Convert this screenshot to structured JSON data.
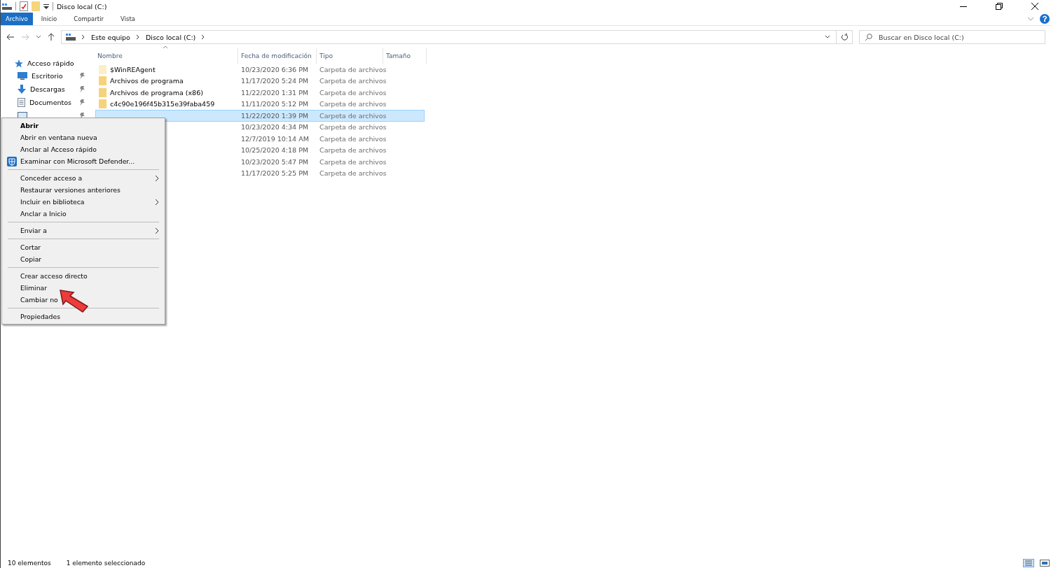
{
  "window": {
    "title": "Disco local (C:)"
  },
  "ribbon_tabs": [
    {
      "label": "Archivo",
      "selected": true
    },
    {
      "label": "Inicio",
      "selected": false
    },
    {
      "label": "Compartir",
      "selected": false
    },
    {
      "label": "Vista",
      "selected": false
    }
  ],
  "breadcrumb": [
    "Este equipo",
    "Disco local (C:)"
  ],
  "search": {
    "placeholder": "Buscar en Disco local (C:)"
  },
  "sidebar": {
    "items": [
      {
        "label": "Acceso rápido",
        "kind": "star",
        "pinned": false
      },
      {
        "label": "Escritorio",
        "kind": "desktop",
        "pinned": true
      },
      {
        "label": "Descargas",
        "kind": "download",
        "pinned": true
      },
      {
        "label": "Documentos",
        "kind": "document",
        "pinned": true
      },
      {
        "kind": "image",
        "pinned": true
      }
    ]
  },
  "table": {
    "columns": [
      "Nombre",
      "Fecha de modificación",
      "Tipo",
      "Tamaño"
    ],
    "rows": [
      {
        "name": "$WinREAgent",
        "date": "10/23/2020 6:36 PM",
        "type": "Carpeta de archivos",
        "selected": false
      },
      {
        "name": "Archivos de programa",
        "date": "11/17/2020 5:24 PM",
        "type": "Carpeta de archivos",
        "selected": false
      },
      {
        "name": "Archivos de programa (x86)",
        "date": "11/22/2020 1:31 PM",
        "type": "Carpeta de archivos",
        "selected": false
      },
      {
        "name": "c4c90e196f45b315e39faba459",
        "date": "11/11/2020 5:12 PM",
        "type": "Carpeta de archivos",
        "selected": false
      },
      {
        "date": "11/22/2020 1:39 PM",
        "type": "Carpeta de archivos",
        "selected": true
      },
      {
        "date": "10/23/2020 4:34 PM",
        "type": "Carpeta de archivos",
        "selected": false
      },
      {
        "date": "12/7/2019 10:14 AM",
        "type": "Carpeta de archivos",
        "selected": false
      },
      {
        "date": "10/25/2020 4:18 PM",
        "type": "Carpeta de archivos",
        "selected": false
      },
      {
        "date": "10/23/2020 5:47 PM",
        "type": "Carpeta de archivos",
        "selected": false
      },
      {
        "date": "11/17/2020 5:25 PM",
        "type": "Carpeta de archivos",
        "selected": false
      }
    ]
  },
  "context_menu": [
    {
      "kind": "item",
      "label": "Abrir",
      "default": true
    },
    {
      "kind": "item",
      "label": "Abrir en ventana nueva"
    },
    {
      "kind": "item",
      "label": "Anclar al Acceso rápido"
    },
    {
      "kind": "icon_item",
      "label": "Examinar con Microsoft Defender..."
    },
    {
      "kind": "separator"
    },
    {
      "kind": "item",
      "label": "Conceder acceso a",
      "submenu": true
    },
    {
      "kind": "item",
      "label": "Restaurar versiones anteriores"
    },
    {
      "kind": "item",
      "label": "Incluir en biblioteca",
      "submenu": true
    },
    {
      "kind": "item",
      "label": "Anclar a Inicio"
    },
    {
      "kind": "separator"
    },
    {
      "kind": "item",
      "label": "Enviar a",
      "submenu": true
    },
    {
      "kind": "separator"
    },
    {
      "kind": "item",
      "label": "Cortar"
    },
    {
      "kind": "item",
      "label": "Copiar"
    },
    {
      "kind": "separator"
    },
    {
      "kind": "item",
      "label": "Crear acceso directo"
    },
    {
      "kind": "item",
      "label": "Eliminar"
    },
    {
      "kind": "item",
      "label": "Cambiar no"
    },
    {
      "kind": "separator"
    },
    {
      "kind": "item",
      "label": "Propiedades"
    }
  ],
  "status_bar": [
    "10 elementos",
    "1 elemento seleccionado"
  ]
}
